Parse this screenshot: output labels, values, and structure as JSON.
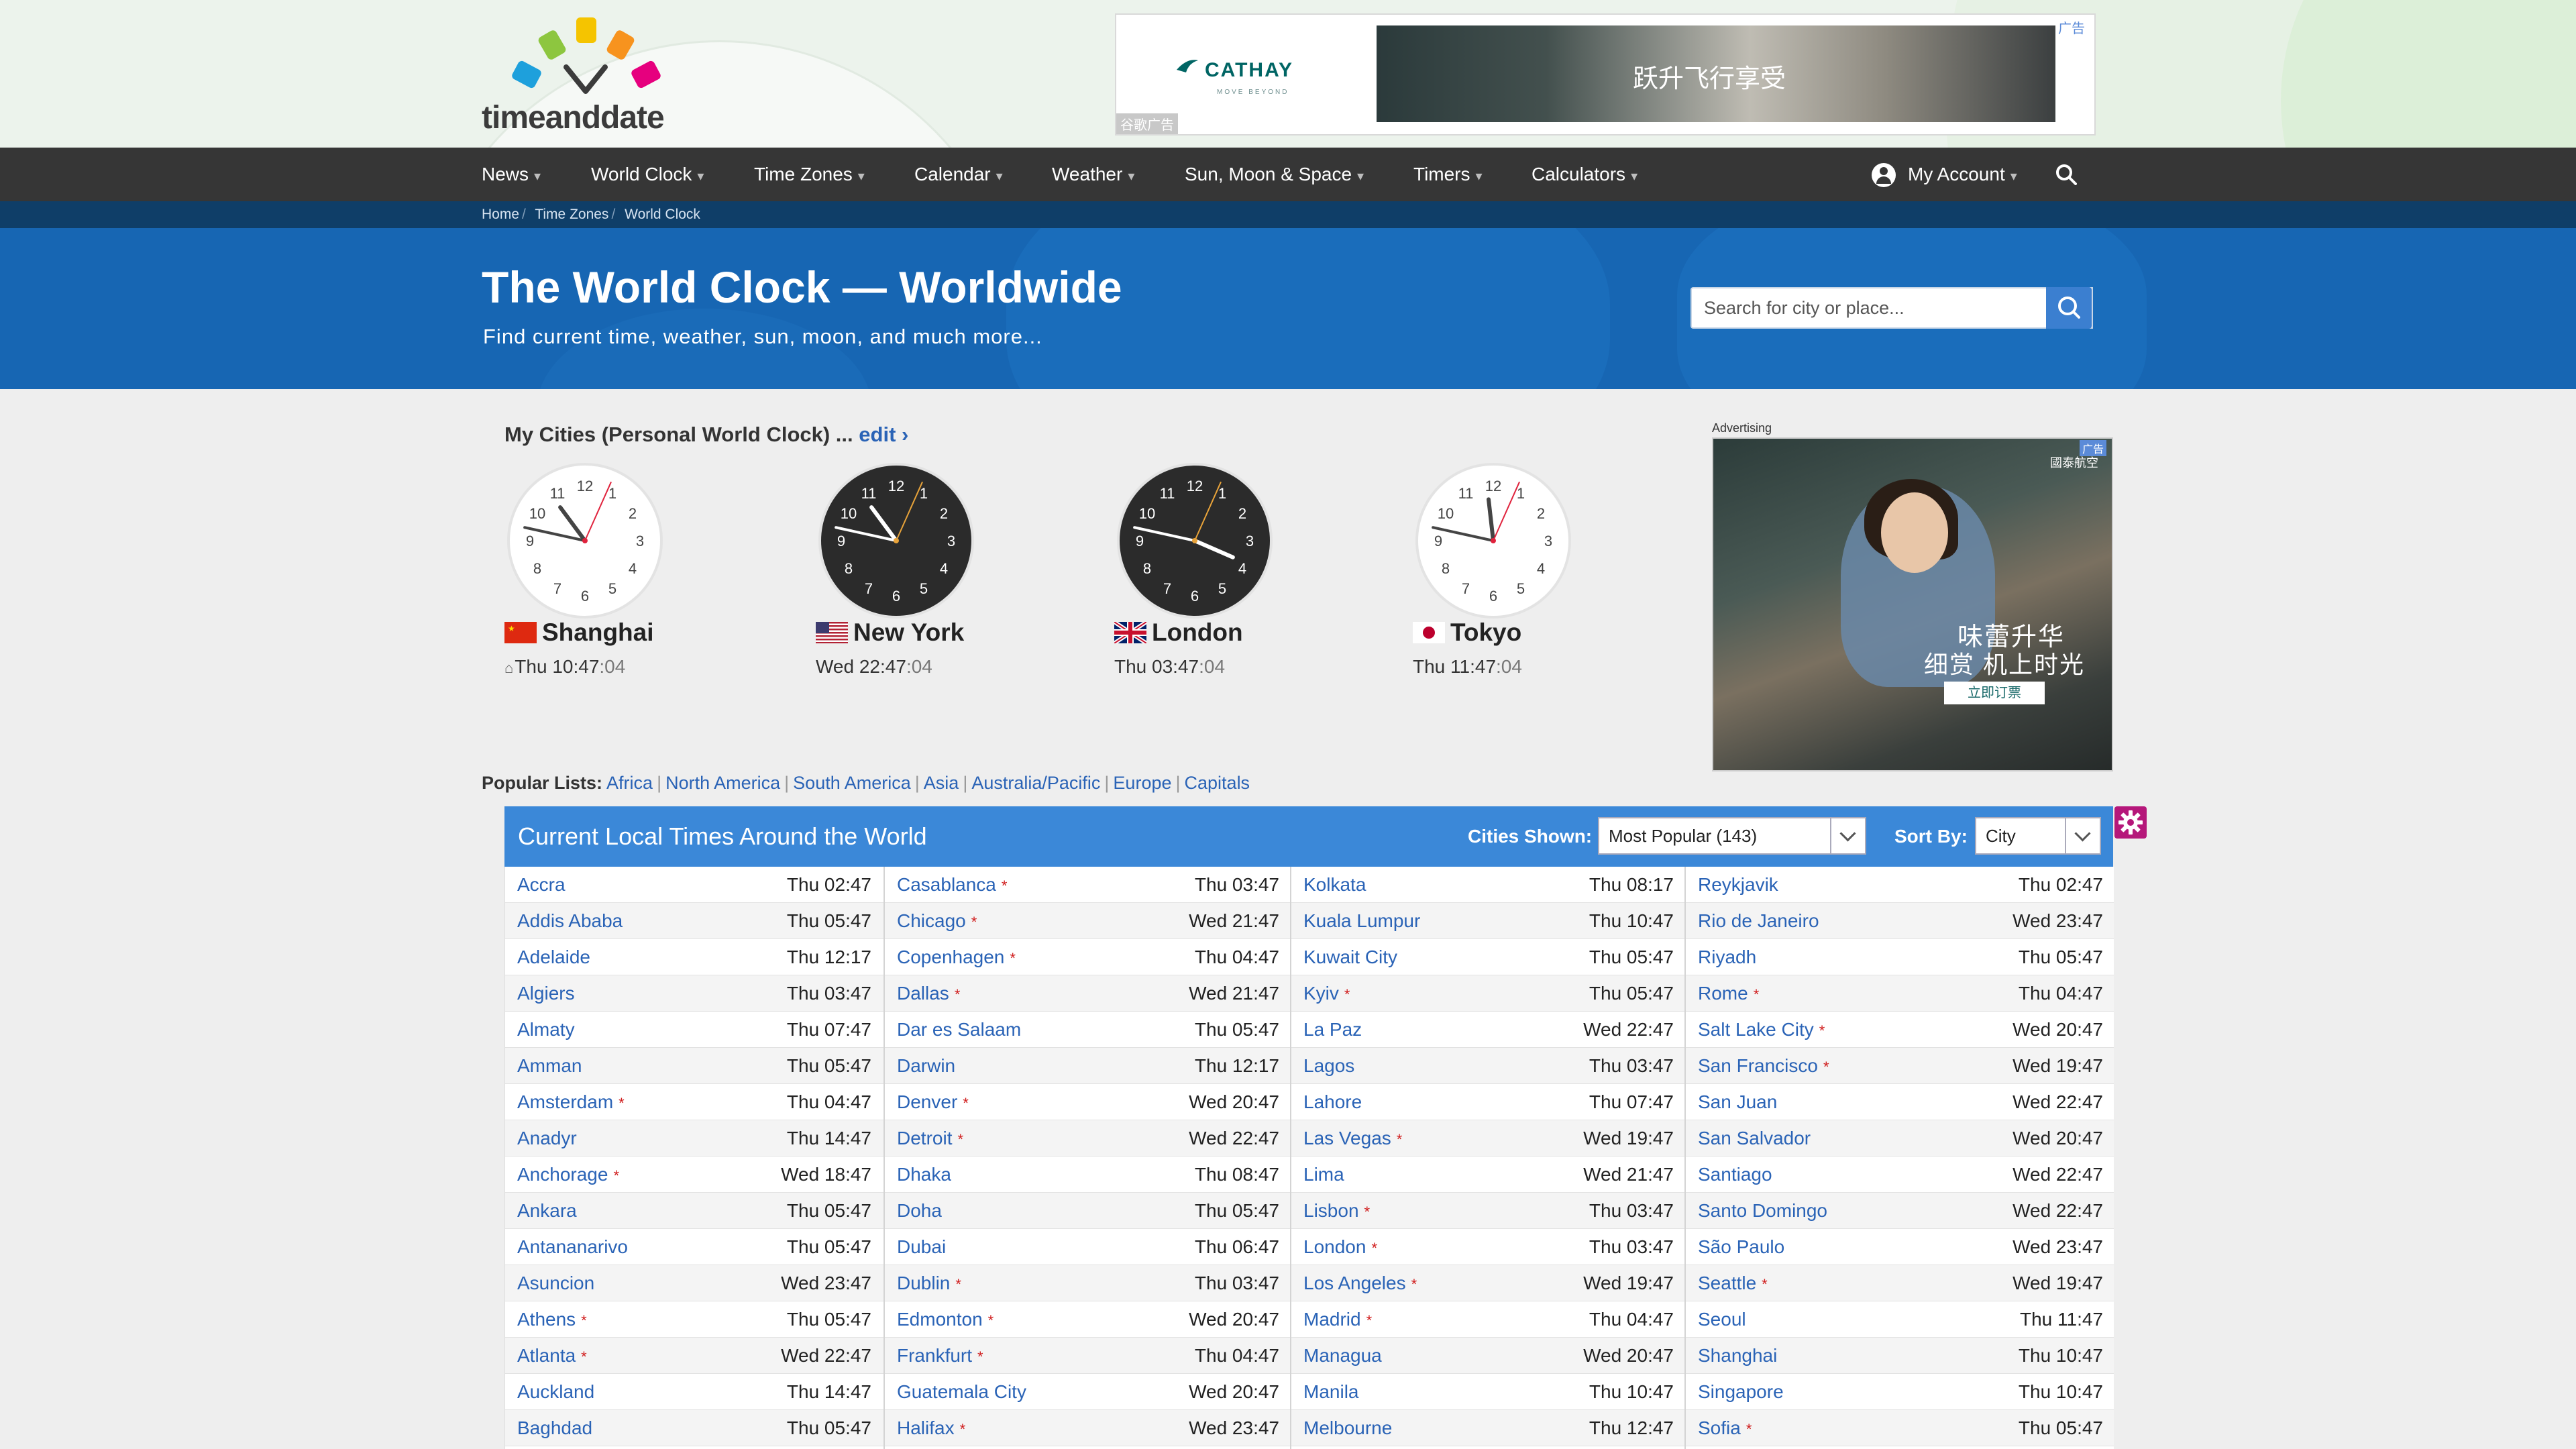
{
  "site": {
    "logo_text": "timeanddate",
    "top_ad": {
      "brand": "CATHAY",
      "brand_sub": "MOVE BEYOND",
      "slogan": "跃升飞行享受",
      "ad_label": "谷歌广告",
      "tag": "广告"
    }
  },
  "nav": {
    "items": [
      {
        "label": "News"
      },
      {
        "label": "World Clock"
      },
      {
        "label": "Time Zones"
      },
      {
        "label": "Calendar"
      },
      {
        "label": "Weather"
      },
      {
        "label": "Sun, Moon & Space"
      },
      {
        "label": "Timers"
      },
      {
        "label": "Calculators"
      }
    ],
    "account_label": "My Account"
  },
  "breadcrumb": [
    "Home",
    "Time Zones",
    "World Clock"
  ],
  "hero": {
    "title": "The World Clock — Worldwide",
    "subtitle": "Find current time, weather, sun, moon, and much more...",
    "search_placeholder": "Search for city or place..."
  },
  "my_cities": {
    "title": "My Cities (Personal World Clock) ...",
    "edit_label": "edit ›",
    "cities": [
      {
        "name": "Shanghai",
        "day": "Thu",
        "time": "10:47",
        "sec": ":04",
        "dark": false,
        "home": true,
        "hours": 10,
        "minutes": 47,
        "seconds": 4
      },
      {
        "name": "New York",
        "day": "Wed",
        "time": "22:47",
        "sec": ":04",
        "dark": true,
        "home": false,
        "hours": 22,
        "minutes": 47,
        "seconds": 4
      },
      {
        "name": "London",
        "day": "Thu",
        "time": "03:47",
        "sec": ":04",
        "dark": true,
        "home": false,
        "hours": 3,
        "minutes": 47,
        "seconds": 4
      },
      {
        "name": "Tokyo",
        "day": "Thu",
        "time": "11:47",
        "sec": ":04",
        "dark": false,
        "home": false,
        "hours": 11,
        "minutes": 47,
        "seconds": 4
      }
    ]
  },
  "side_ad": {
    "label": "Advertising",
    "line1": "味蕾升华",
    "line2": "细赏 机上时光",
    "cta": "立即订票",
    "brand": "國泰航空",
    "tag": "广告"
  },
  "popular_lists": {
    "label": "Popular Lists:",
    "links": [
      "Africa",
      "North America",
      "South America",
      "Asia",
      "Australia/Pacific",
      "Europe",
      "Capitals"
    ]
  },
  "table": {
    "title": "Current Local Times Around the World",
    "cities_shown_label": "Cities Shown:",
    "cities_shown_value": "Most Popular (143)",
    "sort_by_label": "Sort By:",
    "sort_by_value": "City",
    "columns": [
      [
        {
          "city": "Accra",
          "dst": false,
          "time": "Thu 02:47"
        },
        {
          "city": "Addis Ababa",
          "dst": false,
          "time": "Thu 05:47"
        },
        {
          "city": "Adelaide",
          "dst": false,
          "time": "Thu 12:17"
        },
        {
          "city": "Algiers",
          "dst": false,
          "time": "Thu 03:47"
        },
        {
          "city": "Almaty",
          "dst": false,
          "time": "Thu 07:47"
        },
        {
          "city": "Amman",
          "dst": false,
          "time": "Thu 05:47"
        },
        {
          "city": "Amsterdam",
          "dst": true,
          "time": "Thu 04:47"
        },
        {
          "city": "Anadyr",
          "dst": false,
          "time": "Thu 14:47"
        },
        {
          "city": "Anchorage",
          "dst": true,
          "time": "Wed 18:47"
        },
        {
          "city": "Ankara",
          "dst": false,
          "time": "Thu 05:47"
        },
        {
          "city": "Antananarivo",
          "dst": false,
          "time": "Thu 05:47"
        },
        {
          "city": "Asuncion",
          "dst": false,
          "time": "Wed 23:47"
        },
        {
          "city": "Athens",
          "dst": true,
          "time": "Thu 05:47"
        },
        {
          "city": "Atlanta",
          "dst": true,
          "time": "Wed 22:47"
        },
        {
          "city": "Auckland",
          "dst": false,
          "time": "Thu 14:47"
        },
        {
          "city": "Baghdad",
          "dst": false,
          "time": "Thu 05:47"
        }
      ],
      [
        {
          "city": "Casablanca",
          "dst": true,
          "time": "Thu 03:47"
        },
        {
          "city": "Chicago",
          "dst": true,
          "time": "Wed 21:47"
        },
        {
          "city": "Copenhagen",
          "dst": true,
          "time": "Thu 04:47"
        },
        {
          "city": "Dallas",
          "dst": true,
          "time": "Wed 21:47"
        },
        {
          "city": "Dar es Salaam",
          "dst": false,
          "time": "Thu 05:47"
        },
        {
          "city": "Darwin",
          "dst": false,
          "time": "Thu 12:17"
        },
        {
          "city": "Denver",
          "dst": true,
          "time": "Wed 20:47"
        },
        {
          "city": "Detroit",
          "dst": true,
          "time": "Wed 22:47"
        },
        {
          "city": "Dhaka",
          "dst": false,
          "time": "Thu 08:47"
        },
        {
          "city": "Doha",
          "dst": false,
          "time": "Thu 05:47"
        },
        {
          "city": "Dubai",
          "dst": false,
          "time": "Thu 06:47"
        },
        {
          "city": "Dublin",
          "dst": true,
          "time": "Thu 03:47"
        },
        {
          "city": "Edmonton",
          "dst": true,
          "time": "Wed 20:47"
        },
        {
          "city": "Frankfurt",
          "dst": true,
          "time": "Thu 04:47"
        },
        {
          "city": "Guatemala City",
          "dst": false,
          "time": "Wed 20:47"
        },
        {
          "city": "Halifax",
          "dst": true,
          "time": "Wed 23:47"
        }
      ],
      [
        {
          "city": "Kolkata",
          "dst": false,
          "time": "Thu 08:17"
        },
        {
          "city": "Kuala Lumpur",
          "dst": false,
          "time": "Thu 10:47"
        },
        {
          "city": "Kuwait City",
          "dst": false,
          "time": "Thu 05:47"
        },
        {
          "city": "Kyiv",
          "dst": true,
          "time": "Thu 05:47"
        },
        {
          "city": "La Paz",
          "dst": false,
          "time": "Wed 22:47"
        },
        {
          "city": "Lagos",
          "dst": false,
          "time": "Thu 03:47"
        },
        {
          "city": "Lahore",
          "dst": false,
          "time": "Thu 07:47"
        },
        {
          "city": "Las Vegas",
          "dst": true,
          "time": "Wed 19:47"
        },
        {
          "city": "Lima",
          "dst": false,
          "time": "Wed 21:47"
        },
        {
          "city": "Lisbon",
          "dst": true,
          "time": "Thu 03:47"
        },
        {
          "city": "London",
          "dst": true,
          "time": "Thu 03:47"
        },
        {
          "city": "Los Angeles",
          "dst": true,
          "time": "Wed 19:47"
        },
        {
          "city": "Madrid",
          "dst": true,
          "time": "Thu 04:47"
        },
        {
          "city": "Managua",
          "dst": false,
          "time": "Wed 20:47"
        },
        {
          "city": "Manila",
          "dst": false,
          "time": "Thu 10:47"
        },
        {
          "city": "Melbourne",
          "dst": false,
          "time": "Thu 12:47"
        }
      ],
      [
        {
          "city": "Reykjavik",
          "dst": false,
          "time": "Thu 02:47"
        },
        {
          "city": "Rio de Janeiro",
          "dst": false,
          "time": "Wed 23:47"
        },
        {
          "city": "Riyadh",
          "dst": false,
          "time": "Thu 05:47"
        },
        {
          "city": "Rome",
          "dst": true,
          "time": "Thu 04:47"
        },
        {
          "city": "Salt Lake City",
          "dst": true,
          "time": "Wed 20:47"
        },
        {
          "city": "San Francisco",
          "dst": true,
          "time": "Wed 19:47"
        },
        {
          "city": "San Juan",
          "dst": false,
          "time": "Wed 22:47"
        },
        {
          "city": "San Salvador",
          "dst": false,
          "time": "Wed 20:47"
        },
        {
          "city": "Santiago",
          "dst": false,
          "time": "Wed 22:47"
        },
        {
          "city": "Santo Domingo",
          "dst": false,
          "time": "Wed 22:47"
        },
        {
          "city": "São Paulo",
          "dst": false,
          "time": "Wed 23:47"
        },
        {
          "city": "Seattle",
          "dst": true,
          "time": "Wed 19:47"
        },
        {
          "city": "Seoul",
          "dst": false,
          "time": "Thu 11:47"
        },
        {
          "city": "Shanghai",
          "dst": false,
          "time": "Thu 10:47"
        },
        {
          "city": "Singapore",
          "dst": false,
          "time": "Thu 10:47"
        },
        {
          "city": "Sofia",
          "dst": true,
          "time": "Thu 05:47"
        }
      ]
    ]
  },
  "colors": {
    "nav_bg": "#363636",
    "hero_bg": "#1766b3",
    "table_header_bg": "#3b88d8",
    "link": "#2a63b6",
    "dst_marker": "#d01c1c",
    "gear_button": "#b5177a"
  },
  "icons": [
    "logo-icon",
    "account-icon",
    "search-icon",
    "home-icon",
    "gear-icon",
    "chevron-down-icon"
  ]
}
